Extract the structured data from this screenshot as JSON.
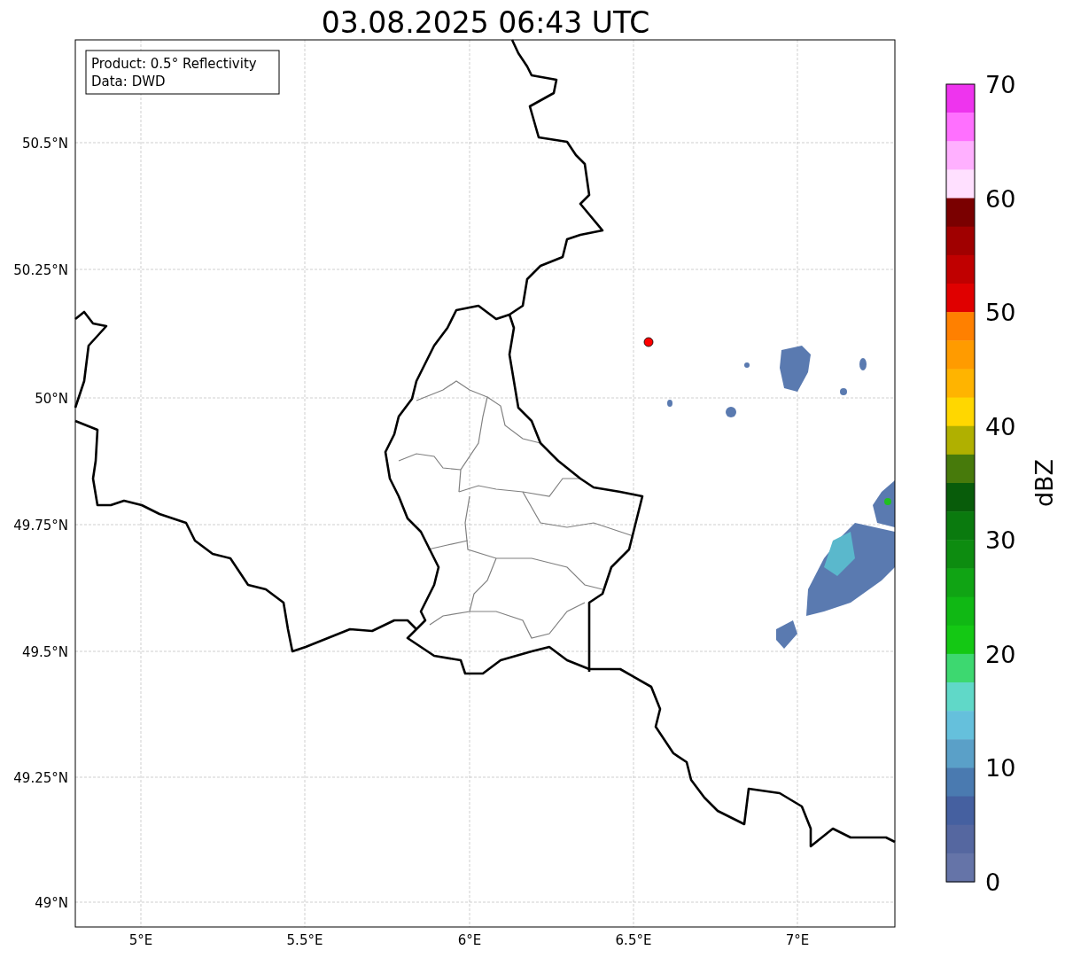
{
  "title": "03.08.2025 06:43 UTC",
  "info_box": {
    "lines": [
      "Product: 0.5° Reflectivity",
      "Data: DWD"
    ]
  },
  "map": {
    "lat_ticks": [
      "50.5°N",
      "50.25°N",
      "50°N",
      "49.75°N",
      "49.5°N",
      "49.25°N",
      "49°N"
    ],
    "lon_ticks": [
      "5°E",
      "5.5°E",
      "6°E",
      "6.5°E",
      "7°E"
    ]
  },
  "colorbar": {
    "label": "dBZ",
    "ticks": [
      "70",
      "60",
      "50",
      "40",
      "30",
      "20",
      "10",
      "0"
    ],
    "bands": [
      {
        "color": "#ee34ee"
      },
      {
        "color": "#ff70ff"
      },
      {
        "color": "#ffb0ff"
      },
      {
        "color": "#ffe0ff"
      },
      {
        "color": "#7a0000"
      },
      {
        "color": "#a00000"
      },
      {
        "color": "#c00000"
      },
      {
        "color": "#e00000"
      },
      {
        "color": "#ff8000"
      },
      {
        "color": "#ff9b00"
      },
      {
        "color": "#ffb400"
      },
      {
        "color": "#ffd700"
      },
      {
        "color": "#b0b000"
      },
      {
        "color": "#477a0b"
      },
      {
        "color": "#085c0a"
      },
      {
        "color": "#0a7a0e"
      },
      {
        "color": "#0d8c10"
      },
      {
        "color": "#10a414"
      },
      {
        "color": "#10b814"
      },
      {
        "color": "#14c814"
      },
      {
        "color": "#3dd870"
      },
      {
        "color": "#60d8c8"
      },
      {
        "color": "#65c0dc"
      },
      {
        "color": "#5aa0c8"
      },
      {
        "color": "#4a7ab0"
      },
      {
        "color": "#4560a0"
      },
      {
        "color": "#5567a0"
      },
      {
        "color": "#6574a8"
      }
    ]
  }
}
